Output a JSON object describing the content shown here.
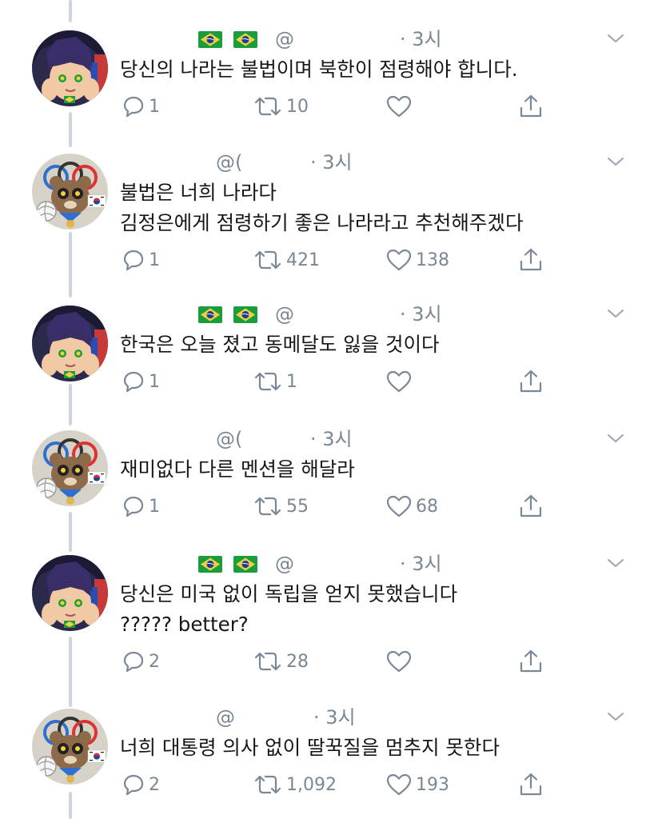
{
  "colors": {
    "text": "#14171a",
    "muted": "#7a8794",
    "thread_line": "#cdd5dd",
    "flag_green": "#1b9d3c",
    "flag_yellow": "#f4d03f",
    "flag_blue": "#1f3f8f"
  },
  "tweets": [
    {
      "author": "user-a",
      "flags": [
        "brazil-flag",
        "brazil-flag"
      ],
      "handle": "@",
      "time": "· 3시",
      "lines": [
        "당신의 나라는 불법이며 북한이 점령해야 합니다."
      ],
      "reply_count": "1",
      "retweet_count": "10",
      "like_count": ""
    },
    {
      "author": "user-b",
      "flags": [],
      "handle": "@(",
      "time": "· 3시",
      "lines": [
        "불법은 너희 나라다",
        "김정은에게 점령하기 좋은 나라라고 추천해주겠다"
      ],
      "reply_count": "1",
      "retweet_count": "421",
      "like_count": "138"
    },
    {
      "author": "user-a",
      "flags": [
        "brazil-flag",
        "brazil-flag"
      ],
      "handle": "@",
      "time": "· 3시",
      "lines": [
        "한국은 오늘 졌고 동메달도 잃을 것이다"
      ],
      "reply_count": "1",
      "retweet_count": "1",
      "like_count": ""
    },
    {
      "author": "user-b",
      "flags": [],
      "handle": "@(",
      "time": "· 3시",
      "lines": [
        "재미없다 다른 멘션을 해달라"
      ],
      "reply_count": "1",
      "retweet_count": "55",
      "like_count": "68"
    },
    {
      "author": "user-a",
      "flags": [
        "brazil-flag",
        "brazil-flag"
      ],
      "handle": "@",
      "time": "· 3시",
      "lines": [
        "당신은 미국 없이 독립을 얻지 못했습니다",
        "????? better?"
      ],
      "reply_count": "2",
      "retweet_count": "28",
      "like_count": ""
    },
    {
      "author": "user-b",
      "flags": [],
      "handle": "@",
      "time": "· 3시",
      "lines": [
        "너희 대통령 의사 없이 딸꾹질을 멈추지 못한다"
      ],
      "reply_count": "2",
      "retweet_count": "1,092",
      "like_count": "193"
    }
  ]
}
